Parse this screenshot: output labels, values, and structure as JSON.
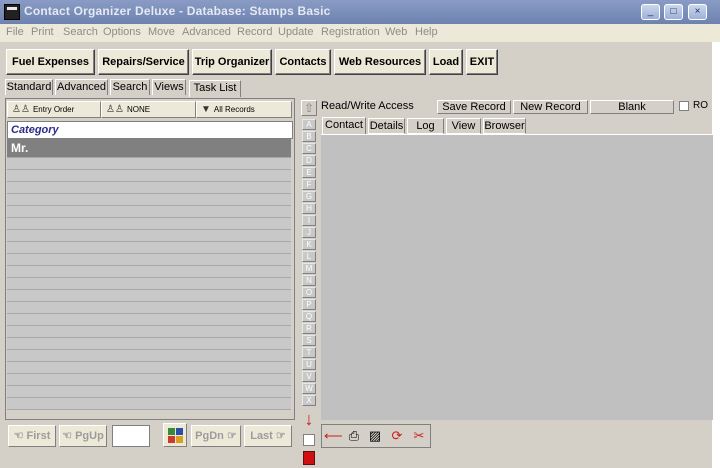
{
  "window": {
    "title": "Contact Organizer Deluxe - Database: Stamps Basic",
    "controls": [
      "_",
      "□",
      "×"
    ]
  },
  "menu": [
    "File",
    "Print",
    "Search",
    "Options",
    "Move",
    "Advanced",
    "Record",
    "Update",
    "Registration",
    "Web",
    "Help"
  ],
  "toolbar": [
    "Fuel Expenses",
    "Repairs/Service",
    "Trip Organizer",
    "Contacts",
    "Web Resources",
    "Load",
    "EXIT"
  ],
  "left_tabs": [
    "Standard",
    "Advanced",
    "Search",
    "Views",
    "Task List"
  ],
  "list_header": {
    "sort": "Entry Order",
    "filter": "NONE",
    "scope": "All Records"
  },
  "category_label": "Category",
  "records": [
    "Mr."
  ],
  "nav": {
    "first": "First",
    "pgup": "PgUp",
    "jump_value": "",
    "pgdn": "PgDn",
    "last": "Last"
  },
  "alphabet": [
    "A",
    "B",
    "C",
    "D",
    "E",
    "F",
    "G",
    "H",
    "I",
    "J",
    "K",
    "L",
    "M",
    "N",
    "O",
    "P",
    "Q",
    "R",
    "S",
    "T",
    "U",
    "V",
    "W",
    "X"
  ],
  "record_bar": {
    "access": "Read/Write Access",
    "save": "Save Record",
    "new": "New Record",
    "blank": "Blank",
    "ro": "RO"
  },
  "detail_tabs": [
    "Contact",
    "Details",
    "Log",
    "View",
    "Browser"
  ],
  "colors": {
    "titlebar": "#7a8db8",
    "category_text": "#2b2b8c",
    "selected_row": "#808080",
    "content_bg": "#c0c0c0"
  },
  "icons": [
    "arrow-left-icon",
    "printer-icon",
    "trash-icon",
    "refresh-icon",
    "delete-record-icon"
  ]
}
